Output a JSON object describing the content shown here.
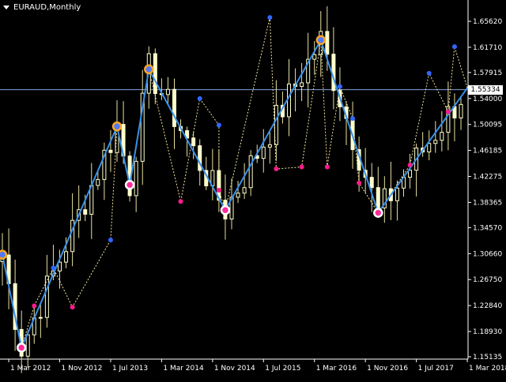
{
  "window": {
    "symbol_timeframe": "EURAUD,Monthly"
  },
  "colors": {
    "background": "#000000",
    "candle_up": "#ffffcc",
    "candle_down": "#ffffcc",
    "wick": "#e8e0a0",
    "zigzag": "#3a8fe8",
    "zigzag_dash": "#f2e6a0",
    "high_dot": "#3366ff",
    "low_dot": "#ff1a8c",
    "major_high_ring": "#f5a623",
    "major_low_ring": "#ffffff",
    "current_price_line": "#7ea6d8"
  },
  "price_axis": {
    "labels": [
      "1.65620",
      "1.61710",
      "1.57915",
      "1.54000",
      "1.50095",
      "1.46185",
      "1.42275",
      "1.38365",
      "1.34570",
      "1.30660",
      "1.26750",
      "1.22840",
      "1.18930",
      "1.15135"
    ],
    "current_price": "1.55334"
  },
  "time_axis": {
    "labels": [
      "1 Mar 2012",
      "1 Nov 2012",
      "1 Jul 2013",
      "1 Mar 2014",
      "1 Nov 2014",
      "1 Jul 2015",
      "1 Mar 2016",
      "1 Nov 2016",
      "1 Jul 2017",
      "1 Mar 2018"
    ]
  },
  "chart_data": {
    "type": "candlestick",
    "symbol": "EURAUD",
    "timeframe": "Monthly",
    "ylim": [
      1.145,
      1.68
    ],
    "zigzag": [
      {
        "date": "Feb 2012",
        "price": 1.305
      },
      {
        "date": "May 2012",
        "price": 1.165
      },
      {
        "date": "Aug 2013",
        "price": 1.498
      },
      {
        "date": "Oct 2013",
        "price": 1.41
      },
      {
        "date": "Jan 2014",
        "price": 1.584
      },
      {
        "date": "Jan 2015",
        "price": 1.372
      },
      {
        "date": "Apr 2016",
        "price": 1.628
      },
      {
        "date": "Jan 2017",
        "price": 1.368
      },
      {
        "date": "Mar 2018",
        "price": 1.556
      }
    ],
    "swing_highs": [
      {
        "date": "Oct 2012",
        "price": 1.285
      },
      {
        "date": "Jul 2013",
        "price": 1.327
      },
      {
        "date": "Sep 2014",
        "price": 1.54
      },
      {
        "date": "Dec 2014",
        "price": 1.5
      },
      {
        "date": "Aug 2015",
        "price": 1.662
      },
      {
        "date": "Jul 2016",
        "price": 1.558
      },
      {
        "date": "Sep 2016",
        "price": 1.51
      },
      {
        "date": "Sep 2017",
        "price": 1.578
      },
      {
        "date": "Jan 2018",
        "price": 1.618
      }
    ],
    "swing_lows": [
      {
        "date": "Jul 2012",
        "price": 1.228
      },
      {
        "date": "Jan 2013",
        "price": 1.226
      },
      {
        "date": "Jun 2014",
        "price": 1.385
      },
      {
        "date": "Dec 2014",
        "price": 1.402
      },
      {
        "date": "Sep 2015",
        "price": 1.434
      },
      {
        "date": "Jan 2016",
        "price": 1.437
      },
      {
        "date": "May 2016",
        "price": 1.437
      },
      {
        "date": "Oct 2016",
        "price": 1.413
      },
      {
        "date": "Jun 2017",
        "price": 1.44
      },
      {
        "date": "Dec 2017",
        "price": 1.52
      }
    ]
  }
}
